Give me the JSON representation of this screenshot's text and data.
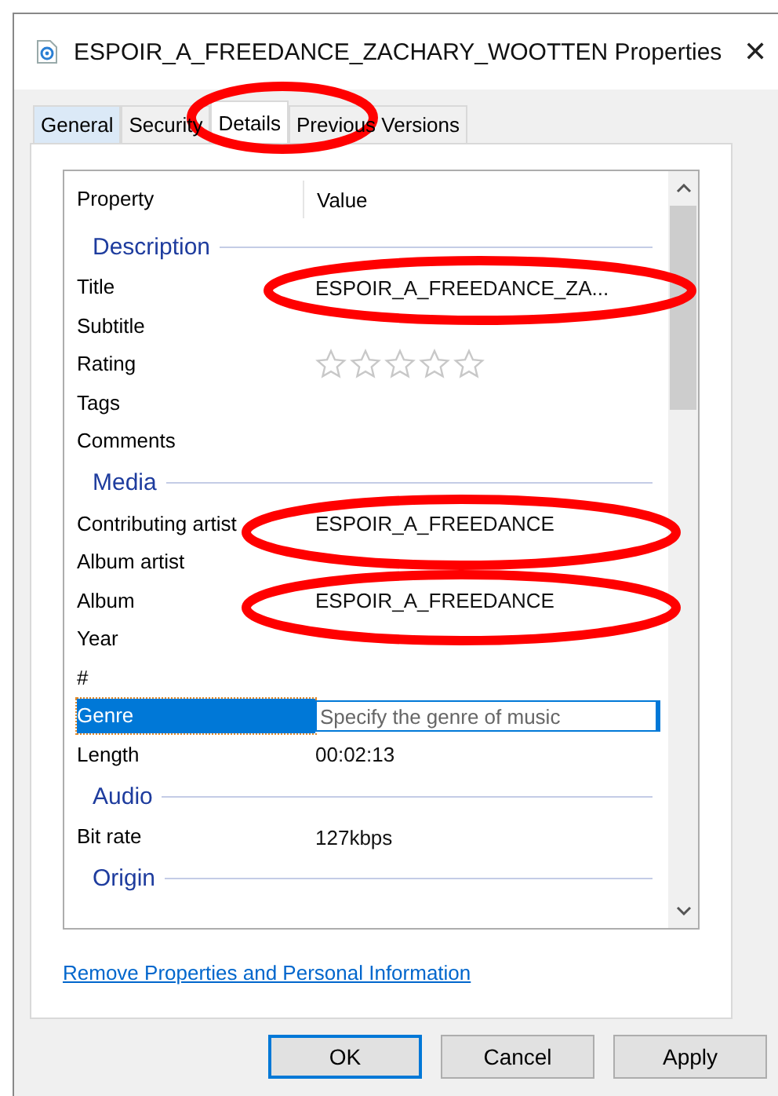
{
  "window": {
    "title": "ESPOIR_A_FREEDANCE_ZACHARY_WOOTTEN Properties",
    "close": "✕"
  },
  "tabs": [
    {
      "label": "General",
      "selected": false
    },
    {
      "label": "Security",
      "selected": false
    },
    {
      "label": "Details",
      "selected": true
    },
    {
      "label": "Previous Versions",
      "selected": false
    }
  ],
  "list": {
    "columns": [
      "Property",
      "Value"
    ],
    "rows": [
      {
        "kind": "group",
        "label": "Description"
      },
      {
        "kind": "property",
        "name": "Title",
        "value": "ESPOIR_A_FREEDANCE_ZA...",
        "selected": false
      },
      {
        "kind": "property",
        "name": "Subtitle",
        "selected": false
      },
      {
        "kind": "rating",
        "name": "Rating",
        "stars": 0,
        "selected": false
      },
      {
        "kind": "property",
        "name": "Tags",
        "selected": false
      },
      {
        "kind": "property",
        "name": "Comments",
        "selected": false
      },
      {
        "kind": "group",
        "label": "Media"
      },
      {
        "kind": "property",
        "name": "Contributing artist",
        "value": "ESPOIR_A_FREEDANCE",
        "selected": false
      },
      {
        "kind": "property",
        "name": "Album artist",
        "selected": false
      },
      {
        "kind": "property",
        "name": "Album",
        "value": "ESPOIR_A_FREEDANCE",
        "selected": false
      },
      {
        "kind": "property",
        "name": "Year",
        "selected": false
      },
      {
        "kind": "property",
        "name": "#",
        "selected": false
      },
      {
        "kind": "edit",
        "name": "Genre",
        "placeholder": "Specify the genre of music",
        "selected": true
      },
      {
        "kind": "property",
        "name": "Length",
        "value": "00:02:13",
        "selected": false
      },
      {
        "kind": "group",
        "label": "Audio"
      },
      {
        "kind": "property",
        "name": "Bit rate",
        "value": "127kbps",
        "selected": false
      },
      {
        "kind": "group",
        "label": "Origin"
      }
    ]
  },
  "link": "Remove Properties and Personal Information",
  "buttons": [
    {
      "label": "OK",
      "default": true
    },
    {
      "label": "Cancel",
      "default": false
    },
    {
      "label": "Apply",
      "default": false
    }
  ]
}
